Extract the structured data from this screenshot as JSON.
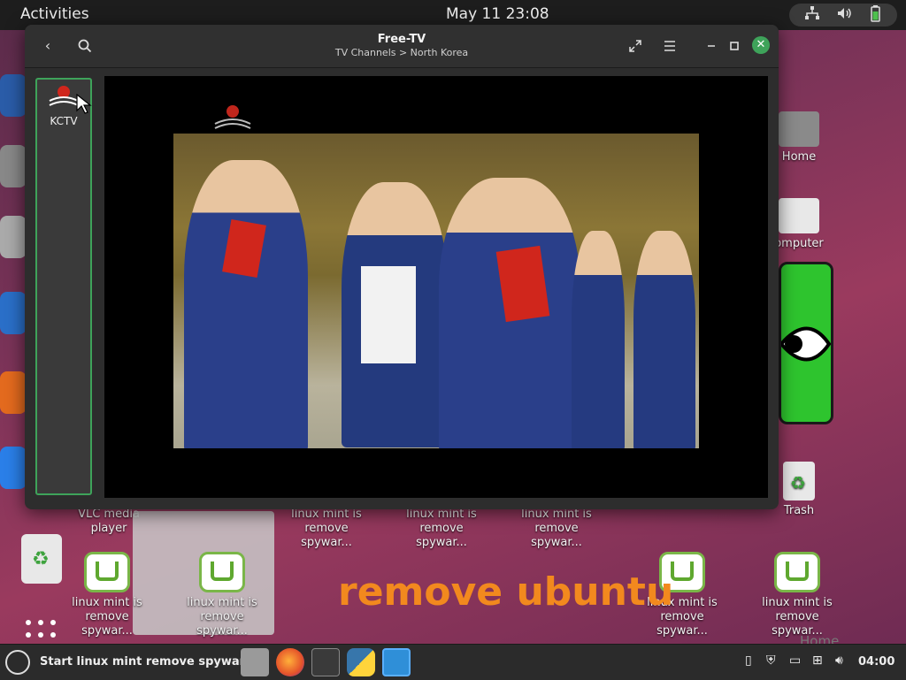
{
  "topbar": {
    "activities": "Activities",
    "clock": "May 11  23:08"
  },
  "window": {
    "title": "Free-TV",
    "subtitle": "TV Channels > North Korea",
    "back_icon": "chevron-left-icon",
    "search_icon": "search-icon",
    "fullscreen_icon": "expand-icon",
    "menu_icon": "hamburger-icon",
    "minimize_icon": "minimize-icon",
    "maximize_icon": "maximize-icon",
    "close_icon": "close-icon",
    "accent": "#3ea35a"
  },
  "sidebar": {
    "channels": [
      {
        "name": "KCTV"
      }
    ]
  },
  "desktop": {
    "icons": [
      {
        "label": "Home"
      },
      {
        "label": "omputer"
      },
      {
        "label": "Trash"
      },
      {
        "label": "VLC media player"
      }
    ],
    "mint_icons": [
      {
        "line1": "linux mint is",
        "line2": "remove spywar..."
      },
      {
        "line1": "linux mint is",
        "line2": "remove spywar..."
      },
      {
        "line1": "linux mint is",
        "line2": "remove spywar..."
      },
      {
        "line1": "linux mint is",
        "line2": "remove spywar..."
      },
      {
        "line1": "linux mint is",
        "line2": "remove spywar..."
      },
      {
        "line1": "linux mint is",
        "line2": "remove spywar..."
      },
      {
        "line1": "linux mint is",
        "line2": "remove spywar..."
      }
    ],
    "banner": "remove ubuntu",
    "faded_label": "Home"
  },
  "taskbar": {
    "start_label": "Start linux mint remove spyware",
    "clock": "04:00",
    "apps": [
      "file-manager-icon",
      "firefox-icon",
      "terminal-icon",
      "python-icon",
      "free-tv-icon"
    ]
  }
}
